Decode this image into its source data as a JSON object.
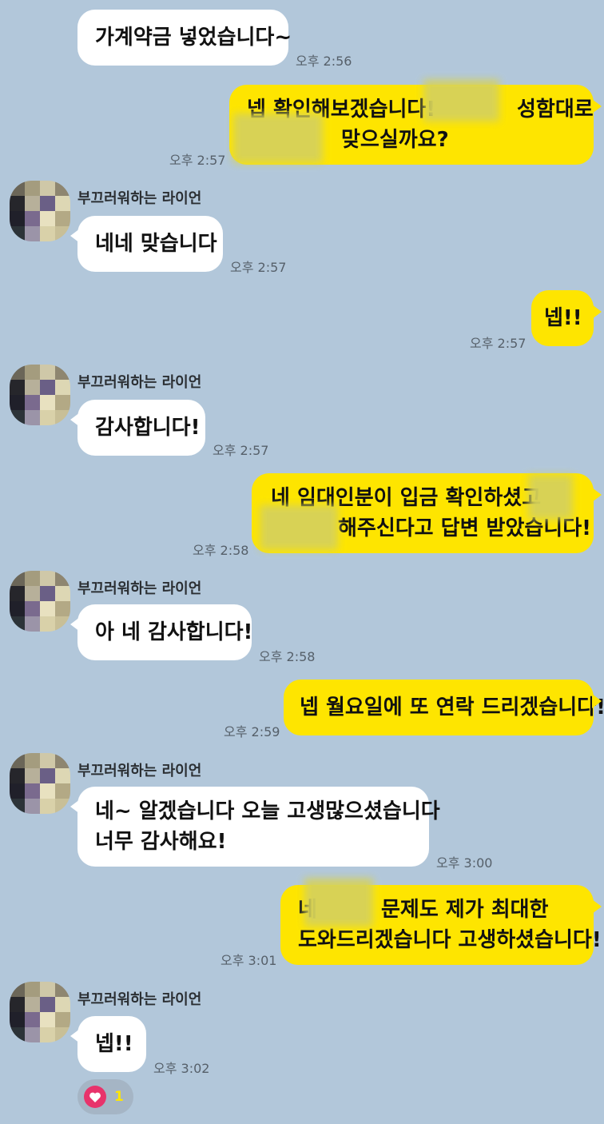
{
  "contact": {
    "name": "부끄러워하는 라이언"
  },
  "colors": {
    "background": "#b2c7da",
    "sent_bubble": "#fee500",
    "received_bubble": "#ffffff",
    "heart": "#e8336b"
  },
  "messages": [
    {
      "side": "received",
      "lines": [
        "가계약금 넣었습니다~"
      ],
      "time": "오후 2:56"
    },
    {
      "side": "sent",
      "lines": [
        "넵 확인해보겠습니다! ",
        "성함대로",
        "맞으실까요?"
      ],
      "time": "오후 2:57"
    },
    {
      "side": "received",
      "lines": [
        "네네 맞습니다"
      ],
      "time": "오후 2:57"
    },
    {
      "side": "sent",
      "lines": [
        "넵!!"
      ],
      "time": "오후 2:57"
    },
    {
      "side": "received",
      "lines": [
        "감사합니다!"
      ],
      "time": "오후 2:57"
    },
    {
      "side": "sent",
      "lines": [
        "네 임대인분이 입금 확인하셨고 ",
        "해주신다고 답변 받았습니다!"
      ],
      "time": "오후 2:58"
    },
    {
      "side": "received",
      "lines": [
        "아 네 감사합니다!"
      ],
      "time": "오후 2:58"
    },
    {
      "side": "sent",
      "lines": [
        "넵 월요일에 또 연락 드리겠습니다!"
      ],
      "time": "오후 2:59"
    },
    {
      "side": "received",
      "lines": [
        "네~ 알겠습니다 오늘 고생많으셨습니다",
        "너무 감사해요!"
      ],
      "time": "오후 3:00"
    },
    {
      "side": "sent",
      "lines": [
        "네",
        "문제도 제가 최대한",
        "도와드리겠습니다 고생하셨습니다!"
      ],
      "time": "오후 3:01"
    },
    {
      "side": "received",
      "lines": [
        "넵!!"
      ],
      "time": "오후 3:02",
      "reaction": {
        "icon": "heart-icon",
        "count": "1"
      }
    }
  ]
}
